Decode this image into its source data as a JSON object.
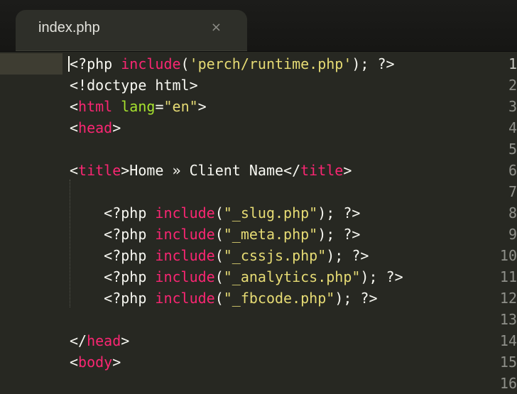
{
  "tab": {
    "label": "index.php",
    "close_glyph": "×"
  },
  "lines": [
    {
      "n": "1",
      "tokens": [
        [
          "p",
          "<?php "
        ],
        [
          "t",
          "include"
        ],
        [
          "p",
          "("
        ],
        [
          "s",
          "'perch/runtime.php'"
        ],
        [
          "p",
          "); ?>"
        ]
      ]
    },
    {
      "n": "2",
      "tokens": [
        [
          "p",
          "<!doctype html>"
        ]
      ]
    },
    {
      "n": "3",
      "tokens": [
        [
          "p",
          "<"
        ],
        [
          "t",
          "html"
        ],
        [
          "p",
          " "
        ],
        [
          "a",
          "lang"
        ],
        [
          "p",
          "="
        ],
        [
          "s",
          "\"en\""
        ],
        [
          "p",
          ">"
        ]
      ]
    },
    {
      "n": "4",
      "tokens": [
        [
          "p",
          "<"
        ],
        [
          "t",
          "head"
        ],
        [
          "p",
          ">"
        ]
      ]
    },
    {
      "n": "5",
      "tokens": []
    },
    {
      "n": "6",
      "tokens": [
        [
          "p",
          "<"
        ],
        [
          "t",
          "title"
        ],
        [
          "p",
          ">Home » Client Name</"
        ],
        [
          "t",
          "title"
        ],
        [
          "p",
          ">"
        ]
      ]
    },
    {
      "n": "7",
      "tokens": []
    },
    {
      "n": "8",
      "tokens": [
        [
          "p",
          "    <?php "
        ],
        [
          "t",
          "include"
        ],
        [
          "p",
          "("
        ],
        [
          "s",
          "\"_slug.php\""
        ],
        [
          "p",
          "); ?>"
        ]
      ]
    },
    {
      "n": "9",
      "tokens": [
        [
          "p",
          "    <?php "
        ],
        [
          "t",
          "include"
        ],
        [
          "p",
          "("
        ],
        [
          "s",
          "\"_meta.php\""
        ],
        [
          "p",
          "); ?>"
        ]
      ]
    },
    {
      "n": "10",
      "tokens": [
        [
          "p",
          "    <?php "
        ],
        [
          "t",
          "include"
        ],
        [
          "p",
          "("
        ],
        [
          "s",
          "\"_cssjs.php\""
        ],
        [
          "p",
          "); ?>"
        ]
      ]
    },
    {
      "n": "11",
      "tokens": [
        [
          "p",
          "    <?php "
        ],
        [
          "t",
          "include"
        ],
        [
          "p",
          "("
        ],
        [
          "s",
          "\"_analytics.php\""
        ],
        [
          "p",
          "); ?>"
        ]
      ]
    },
    {
      "n": "12",
      "tokens": [
        [
          "p",
          "    <?php "
        ],
        [
          "t",
          "include"
        ],
        [
          "p",
          "("
        ],
        [
          "s",
          "\"_fbcode.php\""
        ],
        [
          "p",
          "); ?>"
        ]
      ]
    },
    {
      "n": "13",
      "tokens": []
    },
    {
      "n": "14",
      "tokens": [
        [
          "p",
          "</"
        ],
        [
          "t",
          "head"
        ],
        [
          "p",
          ">"
        ]
      ]
    },
    {
      "n": "15",
      "tokens": [
        [
          "p",
          "<"
        ],
        [
          "t",
          "body"
        ],
        [
          "p",
          ">"
        ]
      ]
    },
    {
      "n": "16",
      "tokens": []
    }
  ],
  "colors": {
    "background": "#272822",
    "keyword": "#f92672",
    "string": "#e6db74",
    "attribute": "#a6e22e",
    "plain": "#f8f8f2",
    "line_number": "#8f908a"
  }
}
